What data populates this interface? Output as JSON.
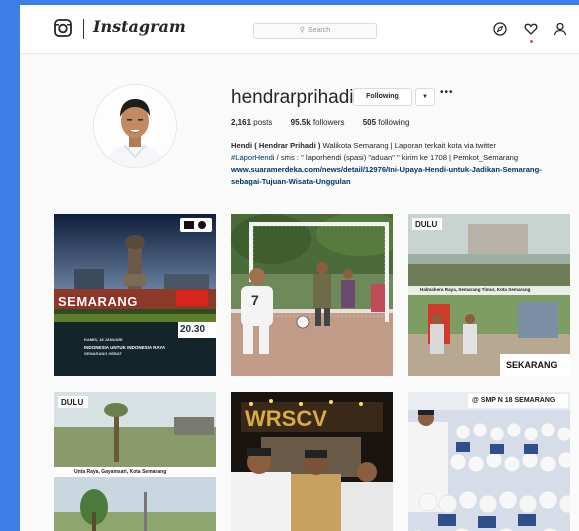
{
  "header": {
    "brand": "Instagram",
    "search_placeholder": "Search",
    "icons": [
      "instagram-camera-icon",
      "compass-icon",
      "heart-icon",
      "person-icon"
    ],
    "accent_dot_color": "#ed4956"
  },
  "profile": {
    "username": "hendrarprihadi",
    "follow_label": "Following",
    "posts_count": "2,161",
    "posts_label": "posts",
    "followers_count": "95.5k",
    "followers_label": "followers",
    "following_count": "505",
    "following_label": "following",
    "bio_name": "Hendi ( Hendrar Prihadi )",
    "bio_line1_rest": " Walikota Semarang | Laporan terkait kota via twitter",
    "bio_hashtag": "#LaporHendi",
    "bio_line2_rest": " / sms : \" laporhendi (spasi) \"aduan\" \" kirim ke 1708 | Pemkot_Semarang",
    "bio_link": "www.suaramerdeka.com/news/detail/12976/Ini-Upaya-Hendi-untuk-Jadikan-Semarang-sebagai-Tujuan-Wisata-Unggulan"
  },
  "posts": {
    "p1": {
      "city_text": "SEMARANG",
      "time": "20.30",
      "line1": "KAMIS, 18 JANUARI",
      "line2": "INDONESIA UNTUK INDONESIA RAYA",
      "line3": "SEMARANG HEBAT"
    },
    "p2": {
      "jersey": "7"
    },
    "p3": {
      "top_label": "DULU",
      "mid_label": "Halmahera Raya, Semarang Timur, Kota Semarang",
      "bottom_label": "SEKARANG"
    },
    "p4": {
      "top_label": "DULU",
      "mid_label": "Unta Raya, Gayamsari, Kota Semarang"
    },
    "p6": {
      "top_label": "@ SMP N 18 SEMARANG"
    }
  }
}
